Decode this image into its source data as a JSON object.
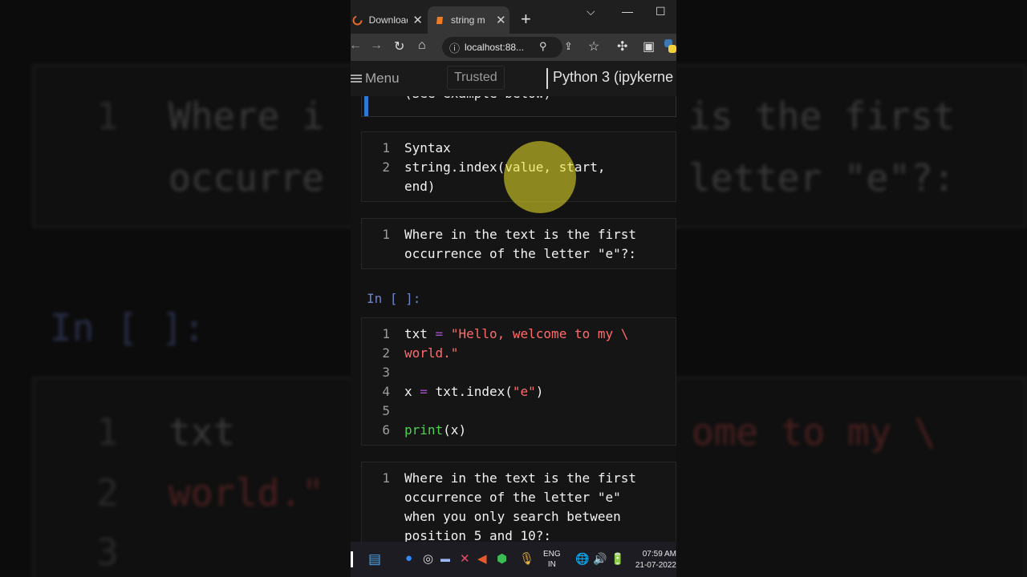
{
  "browser": {
    "tabs": [
      {
        "label": "Download"
      },
      {
        "label": "string m"
      }
    ],
    "address": "localhost:88..."
  },
  "jupyter": {
    "menu_label": "Menu",
    "trusted_label": "Trusted",
    "kernel_label": "Python 3 (ipykerne"
  },
  "cells": {
    "prev_text": "(See example below)",
    "syntax": {
      "lines": [
        "Syntax",
        "string.index(value, start,",
        "end)"
      ]
    },
    "md1": {
      "lines": [
        "Where in the text is the first",
        "occurrence of the letter \"e\"?:"
      ]
    },
    "prompt": "In [ ]:",
    "code": {
      "line1_var": "txt",
      "line1_op": "=",
      "line1_str": "\"Hello, welcome to my \\",
      "line2_str": "world.\"",
      "line4_var": "x",
      "line4_op": "=",
      "line4_call": "txt.index(",
      "line4_arg": "\"e\"",
      "line4_close": ")",
      "line6_kw": "print",
      "line6_rest": "(x)"
    },
    "md2": {
      "lines": [
        "Where in the text is the first",
        "occurrence of the letter \"e\"",
        "when you only search between",
        "position 5 and 10?:"
      ]
    }
  },
  "taskbar": {
    "lang1": "ENG",
    "lang2": "IN",
    "time": "07:59 AM",
    "date": "21-07-2022"
  },
  "background": {
    "line1": "Where i",
    "line1b": "is the first",
    "line2": "occurre",
    "line2b": "letter \"e\"?:",
    "prompt": "In [ ]:",
    "code1a": "txt",
    "code1b": "ome to my \\",
    "code2": "world.\""
  }
}
